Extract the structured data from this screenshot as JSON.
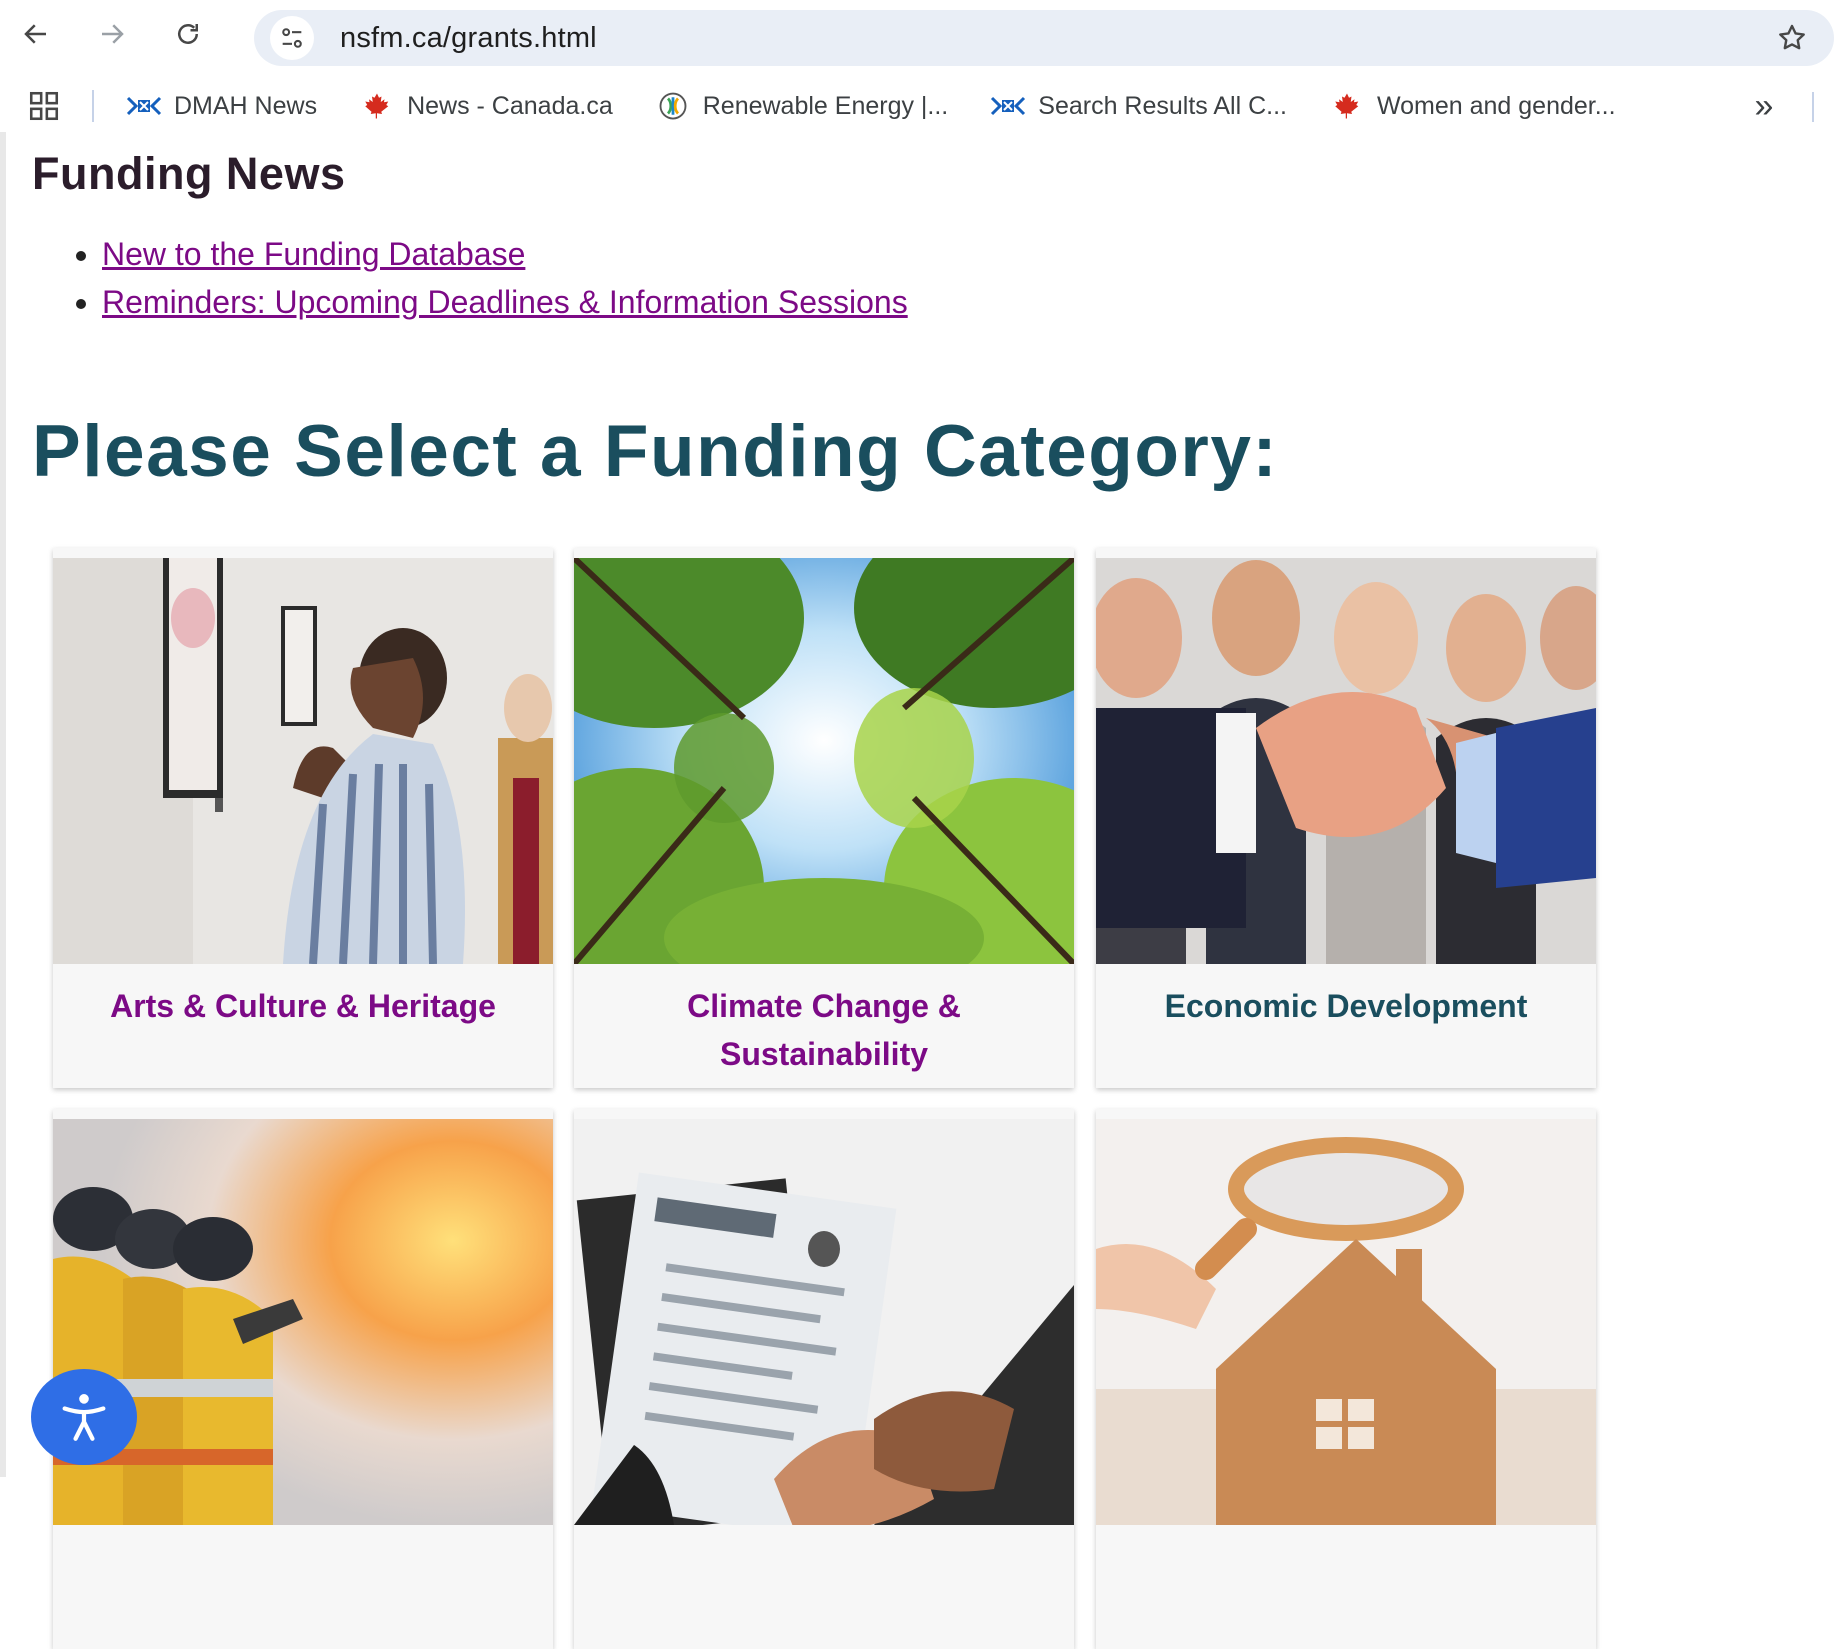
{
  "browser": {
    "url": "nsfm.ca/grants.html",
    "bookmarks": [
      {
        "label": "DMAH News",
        "icon": "ns-flag-icon"
      },
      {
        "label": "News - Canada.ca",
        "icon": "maple-leaf-icon"
      },
      {
        "label": "Renewable Energy |...",
        "icon": "renewable-globe-icon"
      },
      {
        "label": "Search Results All C...",
        "icon": "ns-flag-icon"
      },
      {
        "label": "Women and gender...",
        "icon": "maple-leaf-icon"
      }
    ],
    "more_label": "»"
  },
  "news": {
    "title": "Funding News",
    "links": [
      "New to the Funding Database",
      "Reminders: Upcoming Deadlines & Information Sessions"
    ]
  },
  "main": {
    "title": "Please Select a Funding Category:",
    "categories": [
      {
        "label": "Arts & Culture & Heritage",
        "image": "gallery-visitor-image",
        "color": "#7c0a86"
      },
      {
        "label": "Climate Change & Sustainability",
        "image": "forest-canopy-image",
        "color": "#7c0a86"
      },
      {
        "label": "Economic Development",
        "image": "business-handshake-image",
        "color": "#1a4e5e"
      },
      {
        "label": "",
        "image": "firefighters-image"
      },
      {
        "label": "",
        "image": "resume-handshake-image"
      },
      {
        "label": "",
        "image": "house-magnifier-image"
      }
    ]
  },
  "colors": {
    "link": "#7c0a86",
    "heading": "#1a4e5e",
    "accessibility_button": "#2f6ee6"
  }
}
